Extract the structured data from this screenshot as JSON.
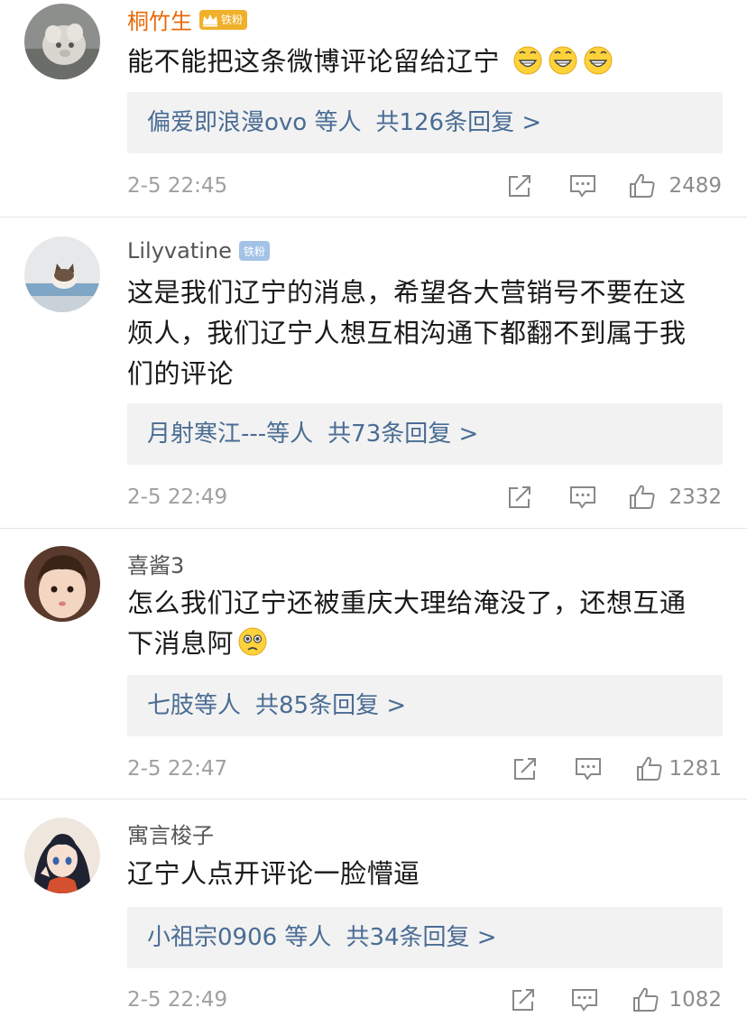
{
  "comments": [
    {
      "username": "桐竹生",
      "badge": "铁粉",
      "badge_style": "gold-crown",
      "name_color": "#e8690a",
      "text": "能不能把这条微博评论留给辽宁",
      "emoji": [
        "grin-emoji",
        "grin-emoji",
        "grin-emoji"
      ],
      "reply_users": "偏爱即浪漫ovo 等人",
      "reply_count": "共126条回复 >",
      "time": "2-5 22:45",
      "likes": "2489"
    },
    {
      "username": "Lilyvatine",
      "badge": "铁粉",
      "badge_style": "blue",
      "name_color": "#555555",
      "text_lines": [
        "这是我们辽宁的消息，希望各大营销号不要在这",
        "烦人，我们辽宁人想互相沟通下都翻不到属于我",
        "们的评论"
      ],
      "reply_users": "月射寒江---等人",
      "reply_count": "共73条回复 >",
      "time": "2-5 22:49",
      "likes": "2332"
    },
    {
      "username": "喜酱3",
      "name_color": "#555555",
      "text_lines": [
        "怎么我们辽宁还被重庆大理给淹没了，还想互通",
        "下消息阿"
      ],
      "emoji": [
        "pitiful-emoji"
      ],
      "reply_users": "七肢等人",
      "reply_count": "共85条回复 >",
      "time": "2-5 22:47",
      "likes": "1281"
    },
    {
      "username": "寓言梭子",
      "name_color": "#555555",
      "text": "辽宁人点开评论一脸懵逼",
      "reply_users": "小祖宗0906 等人",
      "reply_count": "共34条回复 >",
      "time": "2-5 22:49",
      "likes": "1082"
    }
  ],
  "icons": {
    "repost": "repost-icon",
    "comment": "comment-icon",
    "like": "thumbs-up-icon"
  },
  "colors": {
    "link": "#4a6c94",
    "gold_badge": "#f0b02c",
    "blue_badge": "#a3c2e6",
    "username_vip": "#e8690a"
  }
}
